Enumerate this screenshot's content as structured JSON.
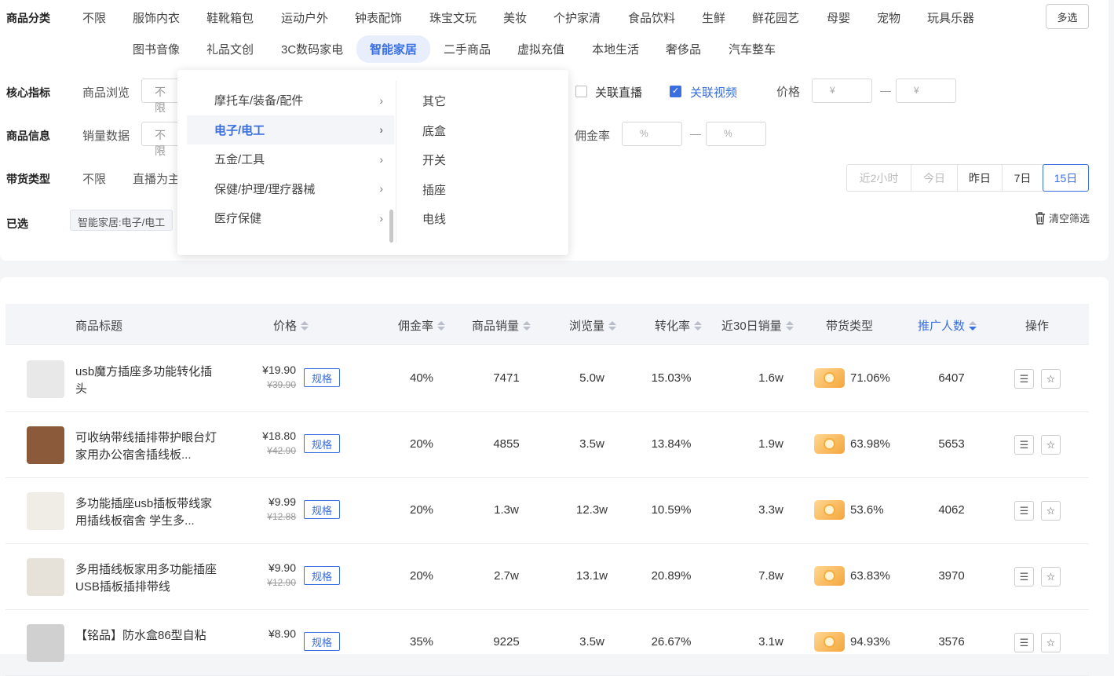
{
  "filters": {
    "category_label": "商品分类",
    "categories_row1": [
      "不限",
      "服饰内衣",
      "鞋靴箱包",
      "运动户外",
      "钟表配饰",
      "珠宝文玩",
      "美妆",
      "个护家清",
      "食品饮料",
      "生鲜",
      "鲜花园艺",
      "母婴",
      "宠物",
      "玩具乐器"
    ],
    "categories_row2": [
      "图书音像",
      "礼品文创",
      "3C数码家电",
      "智能家居",
      "二手商品",
      "虚拟充值",
      "本地生活",
      "奢侈品",
      "汽车整车"
    ],
    "multi_select": "多选",
    "core_label": "核心指标",
    "browse_label": "商品浏览",
    "browse_value": "不限",
    "live_label": "关联直播",
    "video_label": "关联视频",
    "price_label": "价格",
    "price_placeholder": "¥",
    "info_label": "商品信息",
    "sales_label": "销量数据",
    "sales_value": "不限",
    "commission_label": "佣金率",
    "percent_placeholder": "%",
    "range_dash": "—",
    "type_label": "带货类型",
    "type_any": "不限",
    "type_live": "直播为主",
    "time_options": [
      "近2小时",
      "今日",
      "昨日",
      "7日",
      "15日"
    ],
    "selected_label": "已选",
    "selected_tag": "智能家居:电子/电工",
    "clear_label": "清空筛选"
  },
  "dropdown": {
    "left_items": [
      "摩托车/装备/配件",
      "电子/电工",
      "五金/工具",
      "保健/护理/理疗器械",
      "医疗保健"
    ],
    "right_items": [
      "其它",
      "底盒",
      "开关",
      "插座",
      "电线"
    ]
  },
  "table": {
    "headers": [
      "商品标题",
      "价格",
      "佣金率",
      "商品销量",
      "浏览量",
      "转化率",
      "近30日销量",
      "带货类型",
      "推广人数",
      "操作"
    ],
    "spec_label": "规格",
    "rows": [
      {
        "title": "usb魔方插座多功能转化插头",
        "price": "¥19.90",
        "old": "¥39.90",
        "commission": "40%",
        "sales": "7471",
        "views": "5.0w",
        "conv": "15.03%",
        "sales30": "1.6w",
        "live_pct": "71.06%",
        "promoters": "6407"
      },
      {
        "title": "可收纳带线插排带护眼台灯家用办公宿舍插线板...",
        "price": "¥18.80",
        "old": "¥42.90",
        "commission": "20%",
        "sales": "4855",
        "views": "3.5w",
        "conv": "13.84%",
        "sales30": "1.9w",
        "live_pct": "63.98%",
        "promoters": "5653"
      },
      {
        "title": "多功能插座usb插板带线家用插线板宿舍 学生多...",
        "price": "¥9.99",
        "old": "¥12.88",
        "commission": "20%",
        "sales": "1.3w",
        "views": "12.3w",
        "conv": "10.59%",
        "sales30": "3.3w",
        "live_pct": "53.6%",
        "promoters": "4062"
      },
      {
        "title": "多用插线板家用多功能插座USB插板插排带线",
        "price": "¥9.90",
        "old": "¥12.90",
        "commission": "20%",
        "sales": "2.7w",
        "views": "13.1w",
        "conv": "20.89%",
        "sales30": "7.8w",
        "live_pct": "63.83%",
        "promoters": "3970"
      },
      {
        "title": "【铭品】防水盒86型自粘",
        "price": "¥8.90",
        "old": "",
        "commission": "35%",
        "sales": "9225",
        "views": "3.5w",
        "conv": "26.67%",
        "sales30": "3.1w",
        "live_pct": "94.93%",
        "promoters": "3576"
      }
    ]
  },
  "colors": {
    "accent": "#3a6fe0",
    "badge": "#f4a63c"
  }
}
